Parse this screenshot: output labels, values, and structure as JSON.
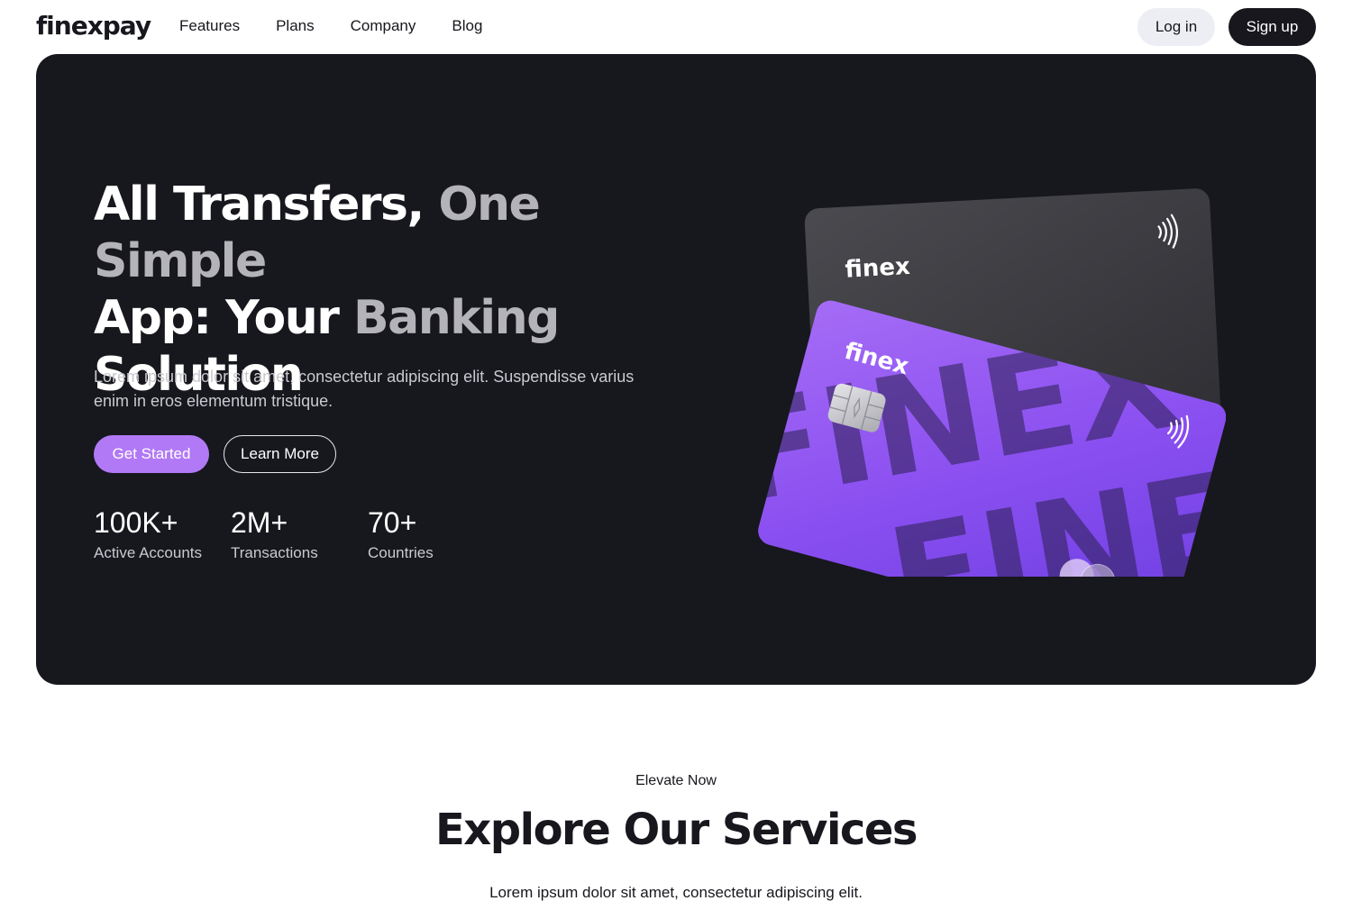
{
  "nav": {
    "logo": "finexpay",
    "links": [
      "Features",
      "Plans",
      "Company",
      "Blog"
    ],
    "login_label": "Log in",
    "signup_label": "Sign up"
  },
  "hero": {
    "title_part1": "All Transfers, ",
    "title_part2": "One Simple",
    "title_part3": "App: Your ",
    "title_part4": "Banking",
    "title_part5": "Solution",
    "subtitle": "Lorem ipsum dolor sit amet, consectetur adipiscing elit. Suspendisse varius enim in eros elementum tristique.",
    "primary_cta": "Get Started",
    "secondary_cta": "Learn More",
    "stats": [
      {
        "value": "100K+",
        "label": "Active Accounts"
      },
      {
        "value": "2M+",
        "label": "Transactions"
      },
      {
        "value": "70+",
        "label": "Countries"
      }
    ]
  },
  "cards": {
    "back_brand": "finex",
    "front_brand": "finex",
    "pattern_text": "FINEX"
  },
  "services": {
    "eyebrow": "Elevate Now",
    "title": "Explore Our Services",
    "subtitle": "Lorem ipsum dolor sit amet, consectetur adipiscing elit."
  },
  "colors": {
    "accent": "#b179f5",
    "hero_bg": "#17171e",
    "dark": "#17171d",
    "login_bg": "#eceef4",
    "card_purple": "#8a4ff0"
  },
  "icons": [
    "contactless-icon",
    "chip-icon",
    "card-network-icon"
  ]
}
